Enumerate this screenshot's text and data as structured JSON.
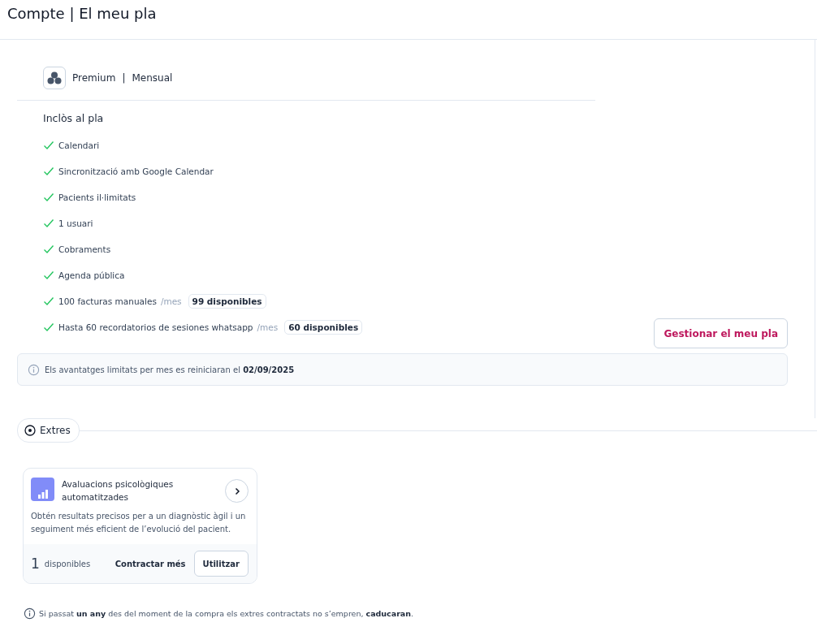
{
  "page_title": "Compte | El meu pla",
  "plan": {
    "name": "Premium",
    "separator": "|",
    "period": "Mensual"
  },
  "included": {
    "title": "Inclòs al pla",
    "items": [
      {
        "label": "Calendari"
      },
      {
        "label": "Sincronització amb Google Calendar"
      },
      {
        "label": "Pacients il·limitats"
      },
      {
        "label": "1 usuari"
      },
      {
        "label": "Cobraments"
      },
      {
        "label": "Agenda pública"
      },
      {
        "label": "100 facturas manuales",
        "unit": "/mes",
        "badge": "99 disponibles"
      },
      {
        "label": "Hasta 60 recordatorios de sesiones whatsapp",
        "unit": "/mes",
        "badge": "60 disponibles"
      }
    ]
  },
  "manage_button": "Gestionar el meu pla",
  "reset_notice": "Els avantatges limitats per mes es reiniciaran el **02/09/2025**",
  "extras": {
    "label": "Extres",
    "cards": [
      {
        "title": "Avaluacions psicològiques automatitzades",
        "description": "Obtén resultats precisos per a un diagnòstic àgil i un seguiment més eficient de l’evolució del pacient.",
        "count": "1",
        "count_label": "disponibles",
        "secondary_action": "Contractar més",
        "primary_action": "Utilitzar"
      }
    ]
  },
  "expiry_note": "Si passat **un any** des del moment de la compra els extres contractats no s’empren, **caducaran**."
}
